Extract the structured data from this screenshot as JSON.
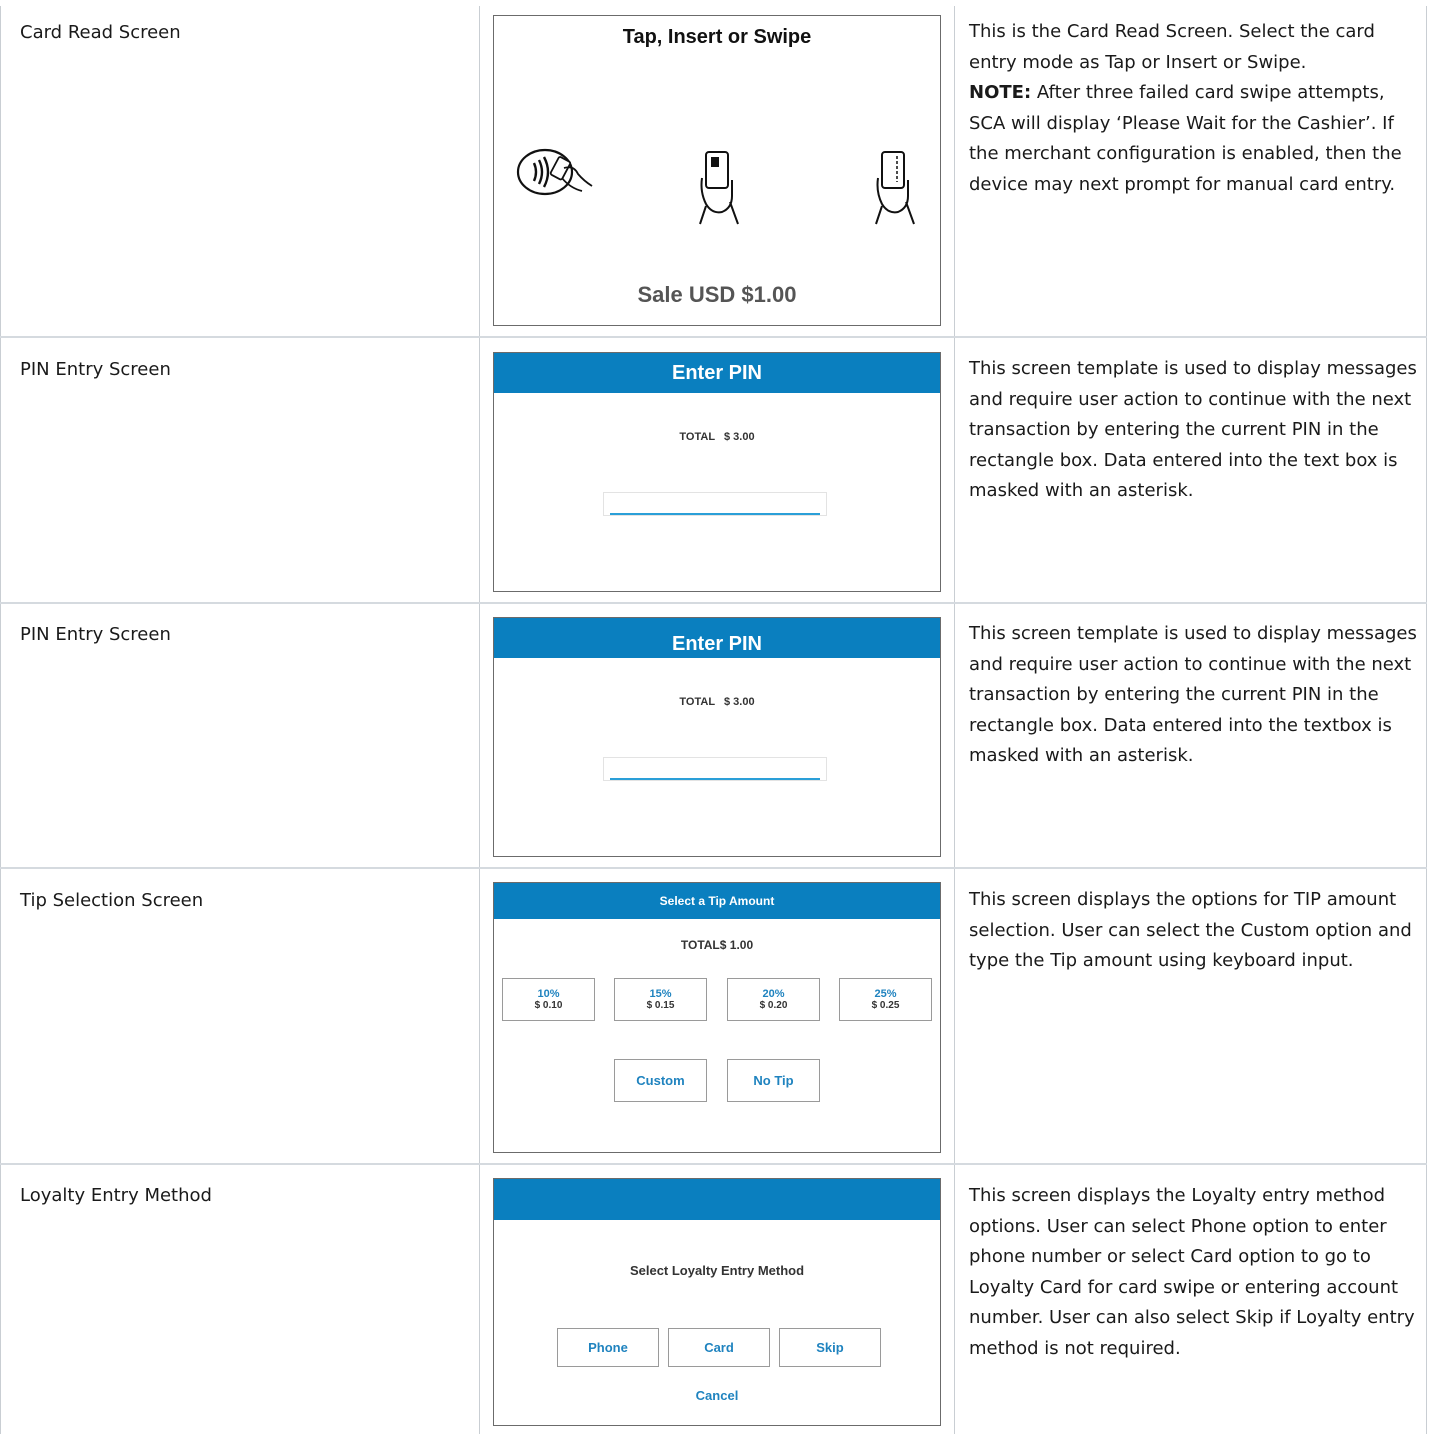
{
  "rows": [
    {
      "label": "Card Read Screen",
      "shot": {
        "title": "Tap, Insert or Swipe",
        "footer": "Sale USD $1.00"
      },
      "desc_note_label": "NOTE:"
    },
    {
      "label": "PIN Entry Screen",
      "shot": {
        "title": "Enter PIN",
        "total": "TOTAL   $ 3.00"
      },
      "desc": "This screen template is used to display messages and require user action to continue with the next transaction by entering the current PIN in the rectangle box. Data entered into the text box is masked with an asterisk."
    },
    {
      "label": "PIN Entry Screen",
      "shot": {
        "title": "Enter PIN",
        "total": "TOTAL   $ 3.00"
      },
      "desc": "This screen template is used to display messages and require user action to continue with the next transaction by entering the current PIN in the rectangle box. Data entered into the textbox is masked with an asterisk."
    },
    {
      "label": "Tip Selection Screen",
      "shot": {
        "title": "Select a Tip Amount",
        "total": "TOTAL$ 1.00",
        "options": [
          {
            "pct": "10%",
            "amt": "$ 0.10"
          },
          {
            "pct": "15%",
            "amt": "$ 0.15"
          },
          {
            "pct": "20%",
            "amt": "$ 0.20"
          },
          {
            "pct": "25%",
            "amt": "$ 0.25"
          }
        ],
        "custom": "Custom",
        "no_tip": "No Tip"
      },
      "desc": "This screen displays the options for TIP amount selection. User can select the Custom option and type the Tip amount using keyboard input."
    },
    {
      "label": "Loyalty Entry Method",
      "shot": {
        "prompt": "Select Loyalty Entry Method",
        "phone": "Phone",
        "card": "Card",
        "skip": "Skip",
        "cancel": "Cancel"
      },
      "desc": "This screen displays the Loyalty entry method options. User can select Phone option to enter phone number or select Card option to go to Loyalty Card for card swipe or entering account number. User can also select Skip if Loyalty entry method is not required."
    }
  ],
  "row1_desc_a": "This is the Card Read Screen. Select the card entry mode as Tap or Insert or Swipe.",
  "row1_desc_b": "After three failed card swipe attempts, SCA will display ‘Please Wait for the Cashier’. If the merchant configuration is enabled, then the device may next prompt for manual card entry.",
  "colors": {
    "brand_blue": "#0a7fbf",
    "link_blue": "#1f83bf",
    "grid": "#c9ced3"
  },
  "icons": [
    "contactless-tap-icon",
    "card-insert-icon",
    "card-swipe-icon"
  ]
}
